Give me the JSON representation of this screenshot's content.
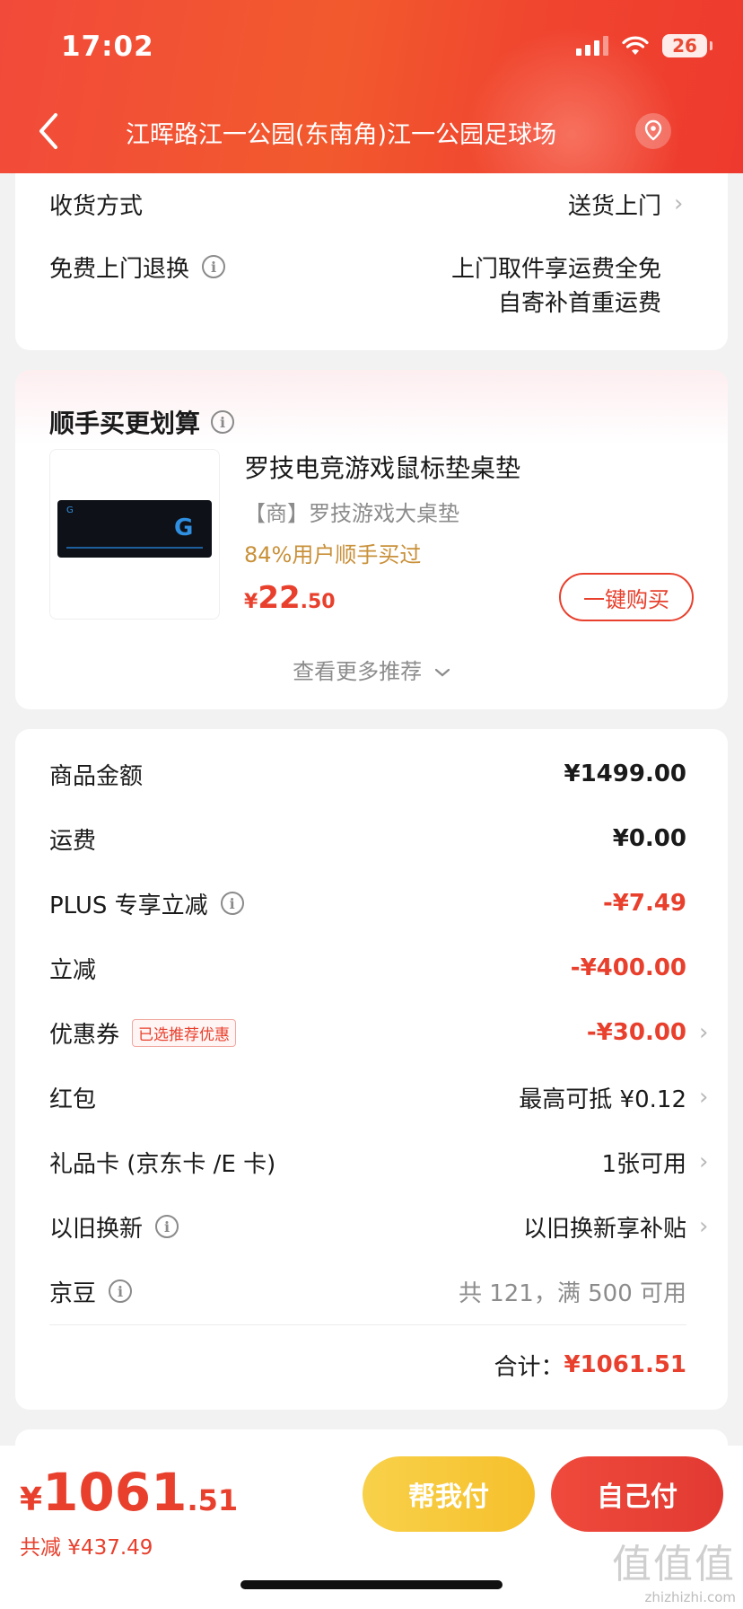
{
  "status_bar": {
    "time": "17:02",
    "battery": "26"
  },
  "header": {
    "address": "江晖路江一公园(东南角)江一公园足球场"
  },
  "delivery": {
    "method_label": "收货方式",
    "method_value": "送货上门",
    "return_label": "免费上门退换",
    "return_line1": "上门取件享运费全免",
    "return_line2": "自寄补首重运费"
  },
  "recommend": {
    "title": "顺手买更划算",
    "product": {
      "name": "罗技电竞游戏鼠标垫桌垫",
      "subtitle": "【商】罗技游戏大桌垫",
      "sold_info": "84%用户顺手买过",
      "price_symbol": "¥",
      "price_int": "22",
      "price_dec": ".50",
      "image_logo": "G",
      "buy_label": "一键购买"
    },
    "more_label": "查看更多推荐"
  },
  "summary": {
    "rows": [
      {
        "label": "商品金额",
        "value": "¥1499.00"
      },
      {
        "label": "运费",
        "value": "¥0.00"
      },
      {
        "label": "PLUS 专享立减",
        "value": "-¥7.49"
      },
      {
        "label": "立减",
        "value": "-¥400.00"
      },
      {
        "label": "优惠券",
        "tag": "已选推荐优惠",
        "value": "-¥30.00"
      },
      {
        "label": "红包",
        "value": "最高可抵 ¥0.12"
      },
      {
        "label": "礼品卡 (京东卡 /E 卡)",
        "value": "1张可用"
      },
      {
        "label": "以旧换新",
        "value": "以旧换新享补贴"
      },
      {
        "label": "京豆",
        "value": "共 121，满 500 可用"
      }
    ],
    "total_label": "合计：",
    "total_value": "¥1061.51"
  },
  "bottom": {
    "price_symbol": "¥",
    "price_int": "1061",
    "price_dec": ".51",
    "saved": "共减 ¥437.49",
    "help_pay": "帮我付",
    "self_pay": "自己付"
  },
  "watermark": {
    "big": "值值值",
    "small": "zhizhizhi.com"
  },
  "colors": {
    "accent": "#e8402d",
    "header": "#f24a3a",
    "help_button": "#f8d14a"
  }
}
